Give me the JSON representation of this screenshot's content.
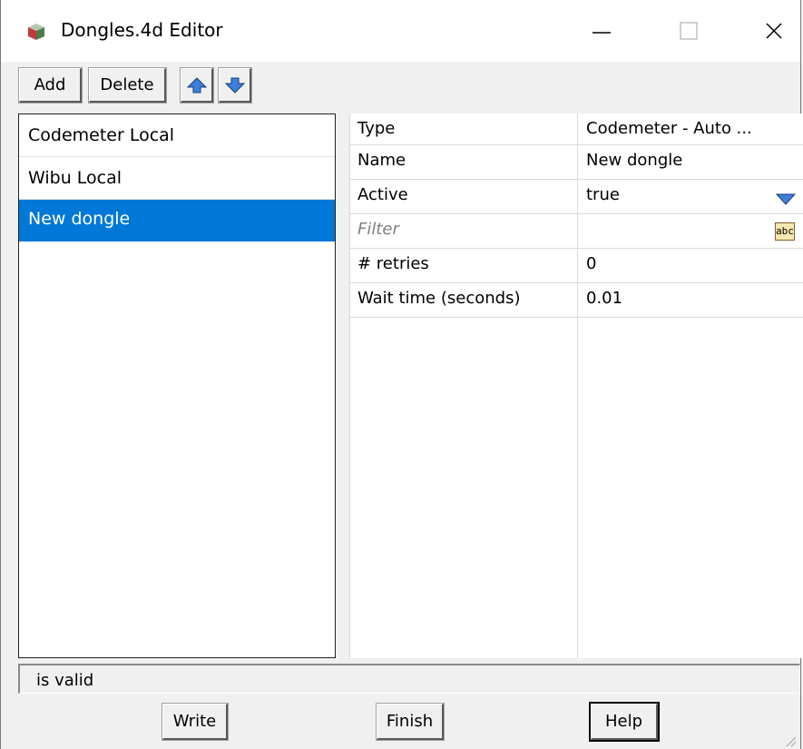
{
  "window": {
    "title": "Dongles.4d Editor"
  },
  "toolbar": {
    "add_label": "Add",
    "delete_label": "Delete",
    "up_icon": "arrow-up-icon",
    "down_icon": "arrow-down-icon"
  },
  "dongle_list": {
    "items": [
      {
        "label": "Codemeter Local",
        "selected": false
      },
      {
        "label": "Wibu Local",
        "selected": false
      },
      {
        "label": "New dongle",
        "selected": true
      }
    ]
  },
  "properties": {
    "rows": [
      {
        "name": "Type",
        "value": "Codemeter - Auto ..."
      },
      {
        "name": "Name",
        "value": "New dongle"
      },
      {
        "name": "Active",
        "value": "true",
        "control": "dropdown-icon"
      },
      {
        "name": "Filter",
        "value": "",
        "control": "abc-icon",
        "control_label": "abc"
      },
      {
        "name": "# retries",
        "value": "0"
      },
      {
        "name": "Wait time (seconds)",
        "value": "0.01"
      }
    ]
  },
  "status": {
    "text": "is valid"
  },
  "buttons": {
    "write_label": "Write",
    "finish_label": "Finish",
    "help_label": "Help"
  },
  "colors": {
    "selection": "#0078d7",
    "arrow_fill": "#3c7fd8",
    "window_bg": "#f0f0f0"
  }
}
